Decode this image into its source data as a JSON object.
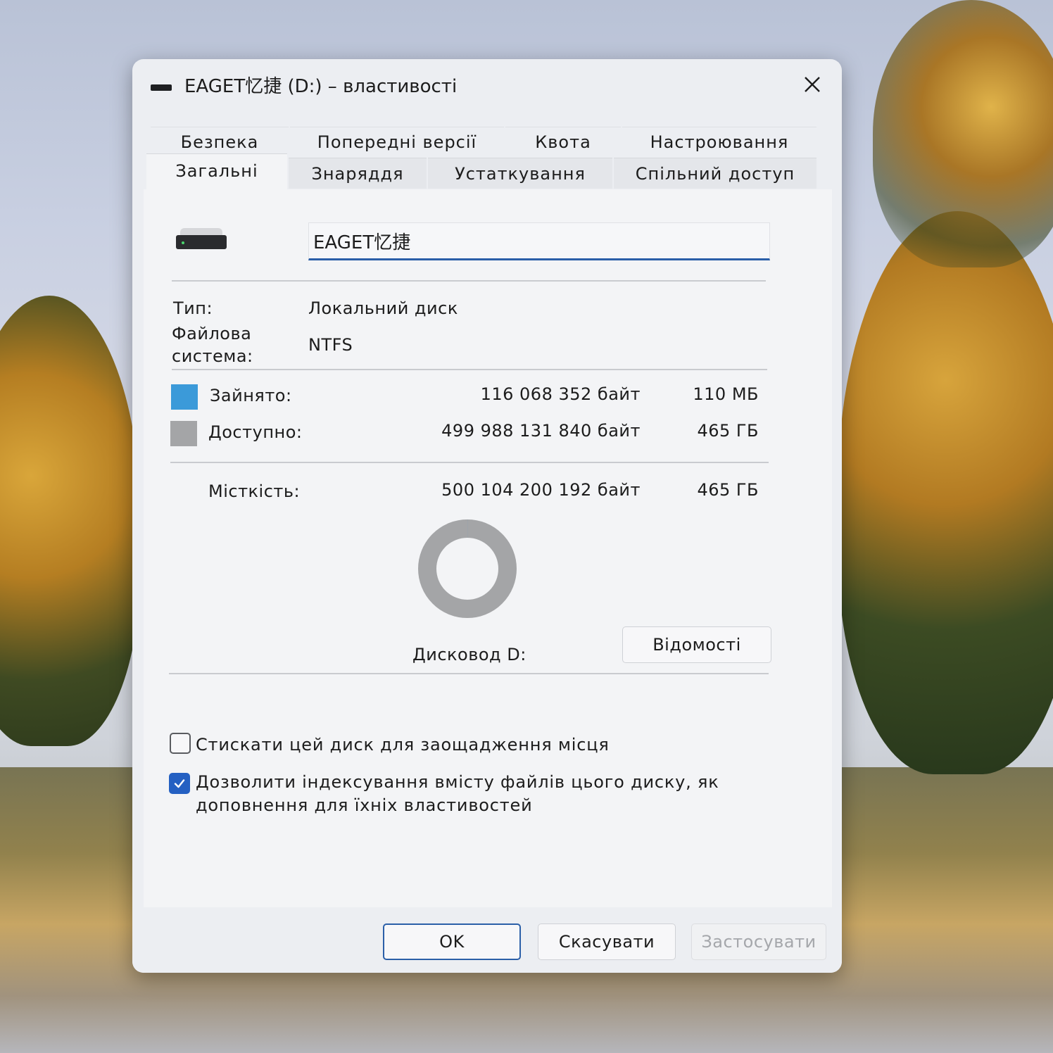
{
  "window": {
    "title": "EAGET忆捷 (D:) – властивості"
  },
  "tabs_row1": [
    {
      "label": "Безпека"
    },
    {
      "label": "Попередні версії"
    },
    {
      "label": "Квота"
    },
    {
      "label": "Настроювання"
    }
  ],
  "tabs_row2": [
    {
      "label": "Загальні",
      "active": true
    },
    {
      "label": "Знаряддя"
    },
    {
      "label": "Устаткування"
    },
    {
      "label": "Спільний доступ"
    }
  ],
  "general": {
    "volume_name": "EAGET忆捷",
    "type_label": "Тип:",
    "type_value": "Локальний диск",
    "fs_label_line1": "Файлова",
    "fs_label_line2": "система:",
    "fs_value": "NTFS",
    "used": {
      "label": "Зайнято:",
      "bytes": "116 068 352 байт",
      "short": "110 МБ",
      "color": "#3b9ad9"
    },
    "free": {
      "label": "Доступно:",
      "bytes": "499 988 131 840 байт",
      "short": "465 ГБ",
      "color": "#a4a5a7"
    },
    "capacity": {
      "label": "Місткість:",
      "bytes": "500 104 200 192 байт",
      "short": "465 ГБ"
    },
    "drive_label": "Дисковод D:",
    "details_button": "Відомості",
    "used_fraction": 0.0002,
    "compress_checkbox": {
      "label": "Стискати цей диск для заощадження місця",
      "checked": false
    },
    "index_checkbox": {
      "label_line1": "Дозволити індексування вмісту файлів цього диску, як",
      "label_line2": "доповнення для їхніх властивостей",
      "checked": true
    }
  },
  "buttons": {
    "ok": "OK",
    "cancel": "Скасувати",
    "apply": "Застосувати"
  }
}
